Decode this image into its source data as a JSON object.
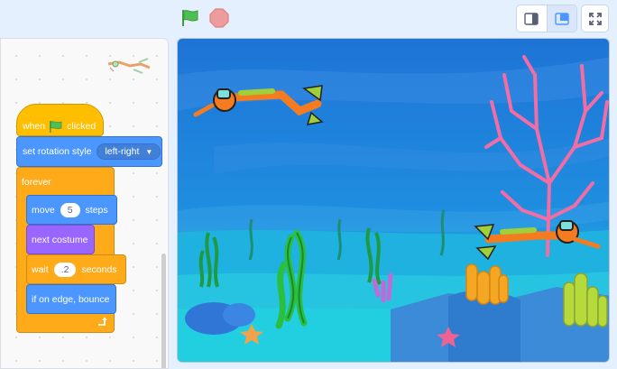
{
  "toolbar": {
    "green_flag_icon": "green-flag-icon",
    "stop_icon": "stop-icon",
    "small_stage_icon": "small-stage-icon",
    "large_stage_icon": "large-stage-icon",
    "fullscreen_icon": "fullscreen-icon"
  },
  "code": {
    "hat": {
      "label_when": "when",
      "label_clicked": "clicked"
    },
    "rotation": {
      "label": "set rotation style",
      "value": "left-right"
    },
    "forever": {
      "label": "forever"
    },
    "move": {
      "label": "move",
      "value": "5",
      "unit": "steps"
    },
    "costume": {
      "label": "next costume"
    },
    "wait": {
      "label": "wait",
      "value": ".2",
      "unit": "seconds"
    },
    "bounce": {
      "label": "if on edge, bounce"
    }
  },
  "stage": {
    "sprite": "diver",
    "backdrop": "underwater"
  },
  "colors": {
    "events": "#ffbf00",
    "motion": "#4c97ff",
    "looks": "#9966ff",
    "control": "#ffab19",
    "accent": "#4c97ff"
  }
}
